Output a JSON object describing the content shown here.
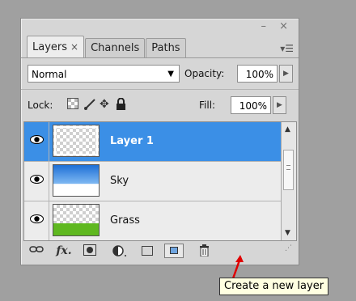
{
  "panel": {
    "window_controls": "– ×",
    "tabs": [
      {
        "label": "Layers",
        "close": "×"
      },
      {
        "label": "Channels"
      },
      {
        "label": "Paths"
      }
    ],
    "menu_icon": "panel-menu-icon"
  },
  "blend": {
    "mode": "Normal",
    "opacity_label": "Opacity:",
    "opacity": "100%"
  },
  "lock": {
    "label": "Lock:",
    "fill_label": "Fill:",
    "fill": "100%"
  },
  "layers": [
    {
      "name": "Layer 1",
      "thumb": "transparent",
      "selected": true
    },
    {
      "name": "Sky",
      "thumb": "sky"
    },
    {
      "name": "Grass",
      "thumb": "grass"
    }
  ],
  "tooltip": {
    "text": "Create a new layer"
  },
  "colors": {
    "selection": "#3b8fe6",
    "panel_bg": "#d6d6d6",
    "tooltip_bg": "#ffffe1",
    "arrow": "#e00000"
  }
}
